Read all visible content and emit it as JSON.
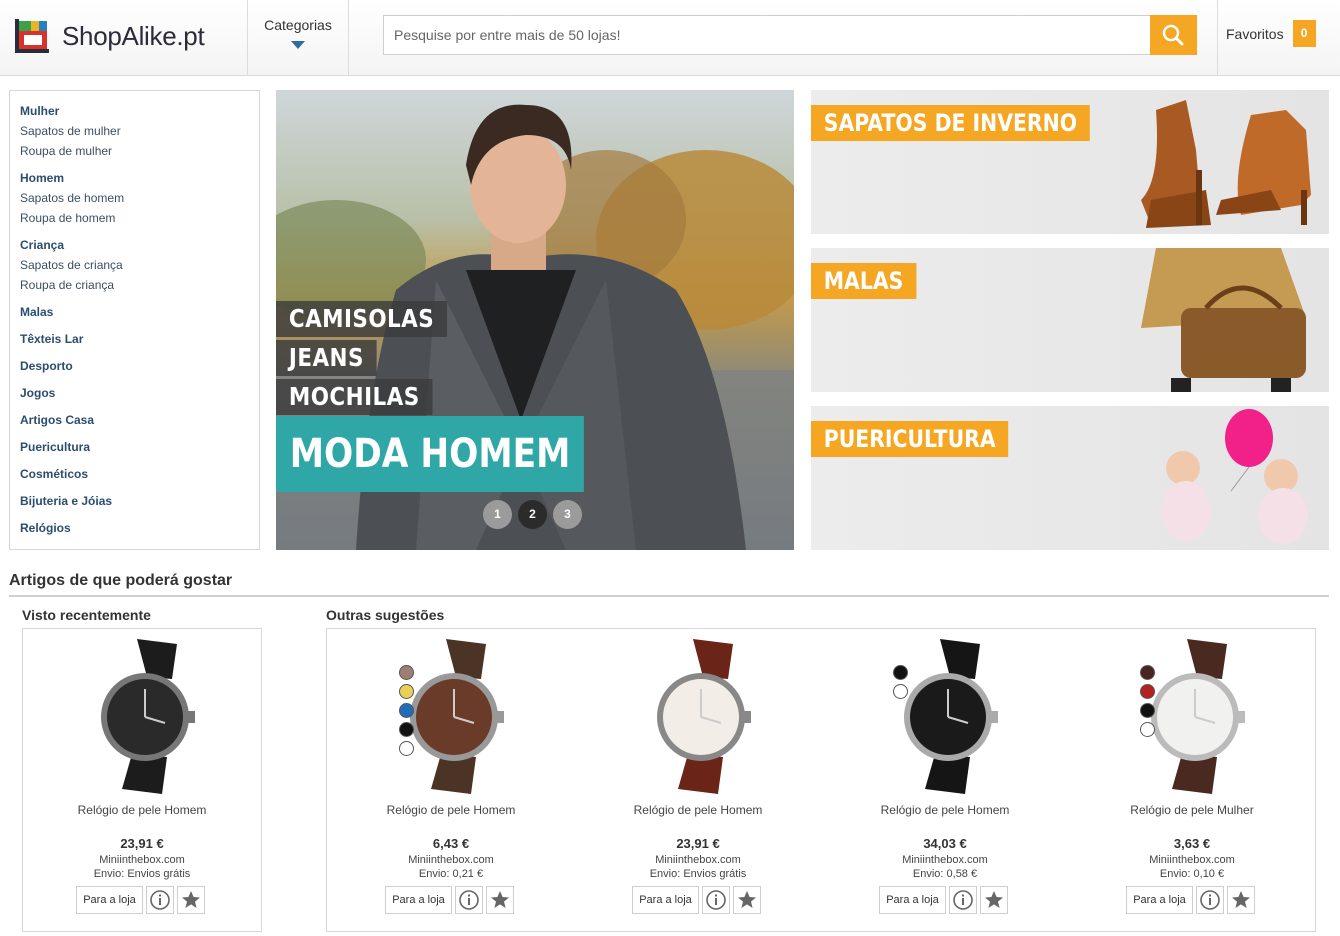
{
  "header": {
    "logo_text": "ShopAlike.pt",
    "categories_label": "Categorias",
    "search_placeholder": "Pesquise por entre mais de 50 lojas!",
    "favorites_label": "Favoritos",
    "favorites_count": "0"
  },
  "sidebar": {
    "groups": [
      {
        "head": "Mulher",
        "items": [
          "Sapatos de mulher",
          "Roupa de mulher"
        ]
      },
      {
        "head": "Homem",
        "items": [
          "Sapatos de homem",
          "Roupa de homem"
        ]
      },
      {
        "head": "Criança",
        "items": [
          "Sapatos de criança",
          "Roupa de criança"
        ]
      }
    ],
    "singles": [
      "Malas",
      "Têxteis Lar",
      "Desporto",
      "Jogos",
      "Artigos Casa",
      "Puericultura",
      "Cosméticos",
      "Bijuteria e Jóias",
      "Relógios"
    ]
  },
  "hero": {
    "tags": [
      "CAMISOLAS",
      "JEANS",
      "MOCHILAS"
    ],
    "main": "MODA HOMEM",
    "dots": [
      "1",
      "2",
      "3"
    ]
  },
  "promos": [
    "SAPATOS DE INVERNO",
    "MALAS",
    "PUERICULTURA"
  ],
  "recommendations": {
    "title": "Artigos de que poderá gostar",
    "recent_label": "Visto recentemente",
    "others_label": "Outras sugestões",
    "button_label": "Para a loja",
    "recent": [
      {
        "name": "Relógio de pele Homem",
        "price": "23,91 €",
        "store": "Miniinthebox.com",
        "shipping": "Envio: Envios grátis"
      }
    ],
    "others": [
      {
        "name": "Relógio de pele Homem",
        "price": "6,43 €",
        "store": "Miniinthebox.com",
        "shipping": "Envio: 0,21 €"
      },
      {
        "name": "Relógio de pele Homem",
        "price": "23,91 €",
        "store": "Miniinthebox.com",
        "shipping": "Envio: Envios grátis"
      },
      {
        "name": "Relógio de pele Homem",
        "price": "34,03 €",
        "store": "Miniinthebox.com",
        "shipping": "Envio: 0,58 €"
      },
      {
        "name": "Relógio de pele Mulher",
        "price": "3,63 €",
        "store": "Miniinthebox.com",
        "shipping": "Envio: 0,10 €"
      }
    ]
  },
  "colors": {
    "accent": "#f5a623",
    "teal": "#2ea7a6",
    "link": "#2b4d6e"
  }
}
